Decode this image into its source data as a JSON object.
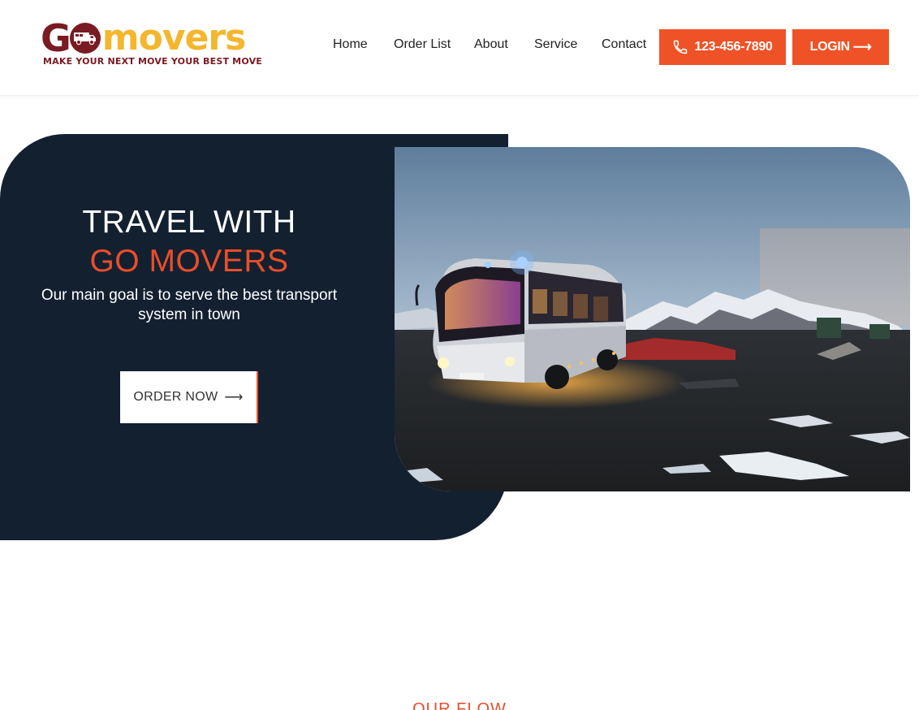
{
  "brand": {
    "logo_g": "G",
    "logo_movers": "movers",
    "tagline": "MAKE YOUR NEXT MOVE YOUR BEST MOVE",
    "colors": {
      "maroon": "#7a1a23",
      "gold": "#f4b62c"
    }
  },
  "nav": {
    "items": [
      {
        "label": "Home"
      },
      {
        "label": "Order List"
      },
      {
        "label": "About"
      },
      {
        "label": "Service"
      },
      {
        "label": "Contact"
      }
    ]
  },
  "header_actions": {
    "phone_label": "123-456-7890",
    "phone_icon": "phone-icon",
    "login_label": "LOGIN",
    "login_arrow": "⟶",
    "accent": "#ef5227"
  },
  "hero": {
    "title_line1": "TRAVEL WITH",
    "title_line2": "GO MOVERS",
    "subtitle": "Our main goal is to serve the best transport system in town",
    "cta_label": "ORDER NOW",
    "cta_arrow": "⟶",
    "panel_color": "#132030",
    "highlight_color": "#e84e2a",
    "image": "bus-at-dusk-mountains-photo"
  },
  "next_section": {
    "kicker": "OUR FLOW"
  }
}
